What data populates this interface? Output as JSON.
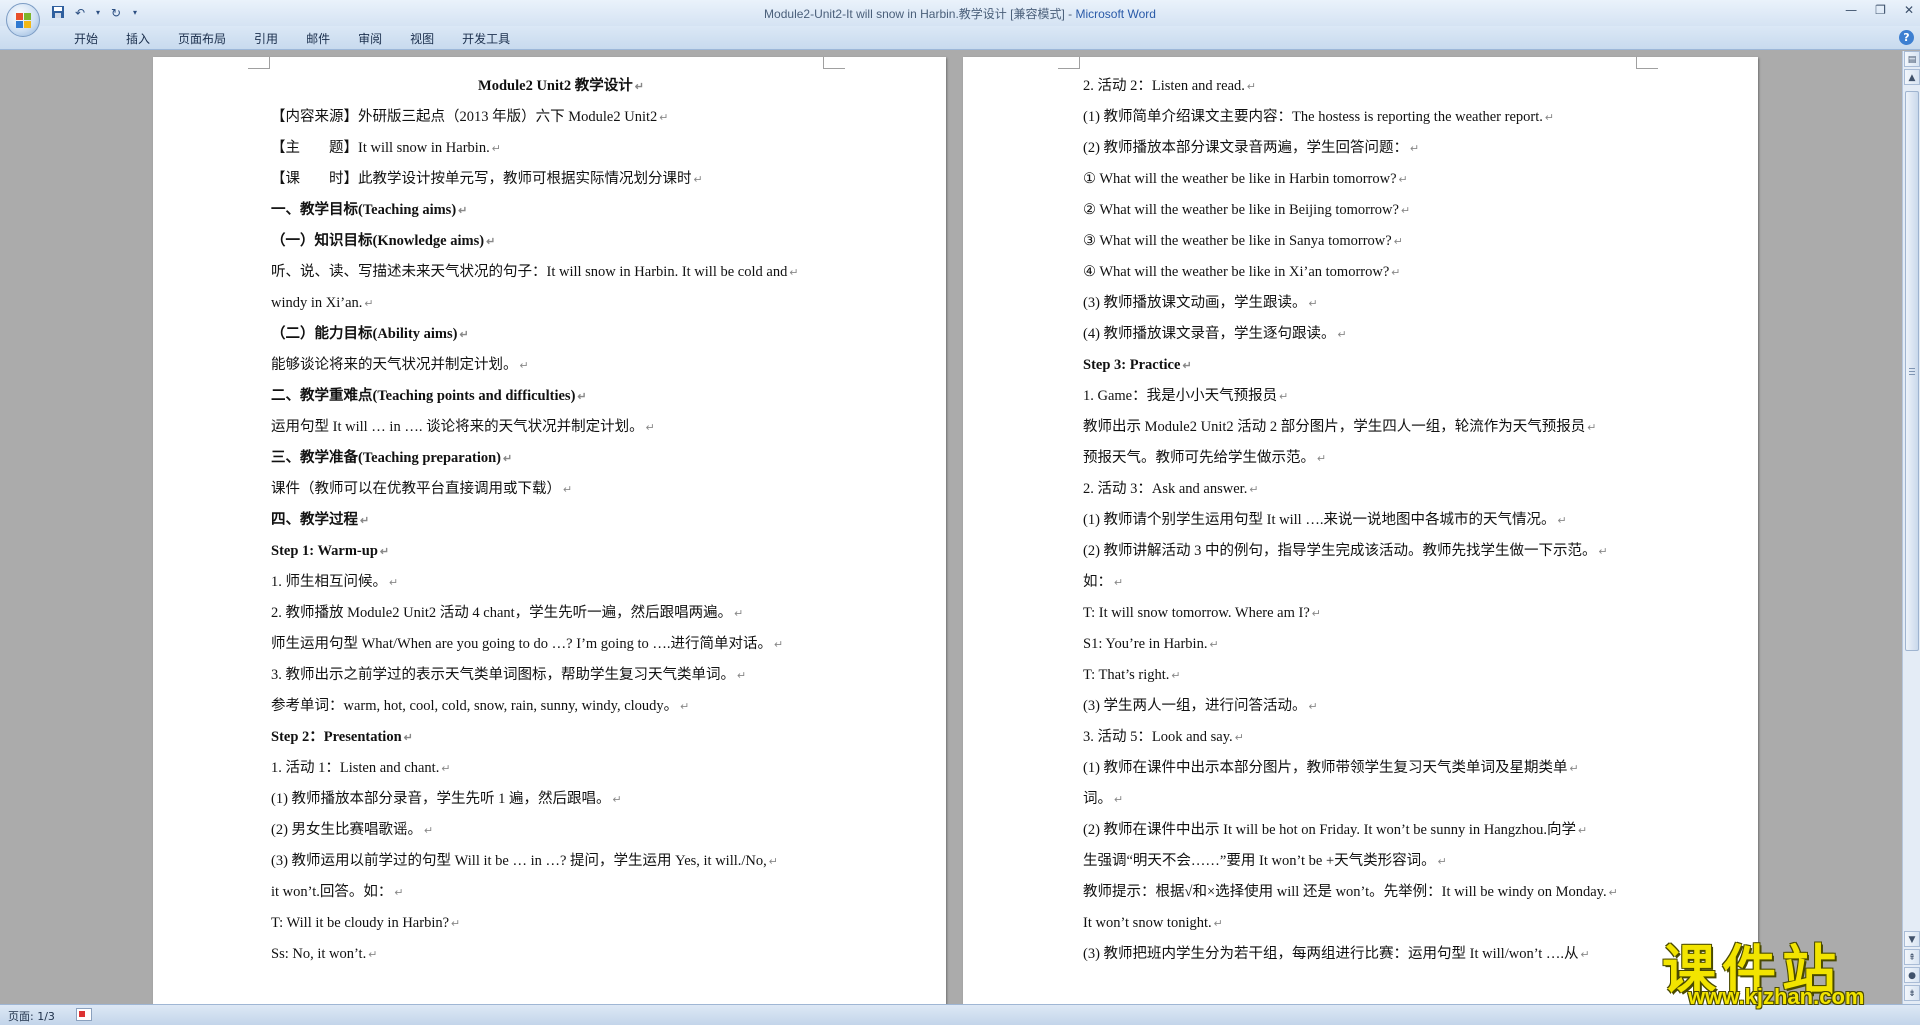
{
  "window": {
    "title": "Module2-Unit2-It will snow in Harbin.教学设计 [兼容模式] - ",
    "app_name": "Microsoft Word"
  },
  "ribbon": {
    "tabs": [
      "开始",
      "插入",
      "页面布局",
      "引用",
      "邮件",
      "审阅",
      "视图",
      "开发工具"
    ]
  },
  "document": {
    "page1": [
      {
        "text": "Module2 Unit2 教学设计",
        "style": "title"
      },
      {
        "text": "【内容来源】外研版三起点（2013 年版）六下 Module2 Unit2",
        "style": "normal"
      },
      {
        "text": "【主　　题】It will snow in Harbin.",
        "style": "normal"
      },
      {
        "text": "【课　　时】此教学设计按单元写，教师可根据实际情况划分课时",
        "style": "normal"
      },
      {
        "text": "一、教学目标(Teaching aims)",
        "style": "bold"
      },
      {
        "text": "（一）知识目标(Knowledge aims)",
        "style": "bold"
      },
      {
        "text": "听、说、读、写描述未来天气状况的句子：It will snow in Harbin. It will be cold and",
        "style": "normal"
      },
      {
        "text": "windy in Xi’an.",
        "style": "normal"
      },
      {
        "text": "（二）能力目标(Ability aims)",
        "style": "bold"
      },
      {
        "text": "能够谈论将来的天气状况并制定计划。",
        "style": "normal"
      },
      {
        "text": "二、教学重难点(Teaching points and difficulties)",
        "style": "bold"
      },
      {
        "text": "运用句型 It will … in …. 谈论将来的天气状况并制定计划。",
        "style": "normal"
      },
      {
        "text": "三、教学准备(Teaching preparation)",
        "style": "bold"
      },
      {
        "text": "课件（教师可以在优教平台直接调用或下载）",
        "style": "normal"
      },
      {
        "text": "四、教学过程",
        "style": "bold"
      },
      {
        "text": "Step 1: Warm-up",
        "style": "bold"
      },
      {
        "text": "1. 师生相互问候。",
        "style": "normal"
      },
      {
        "text": "2. 教师播放 Module2 Unit2 活动 4 chant，学生先听一遍，然后跟唱两遍。",
        "style": "normal"
      },
      {
        "text": "师生运用句型 What/When are you going to do …? I’m going to ….进行简单对话。",
        "style": "normal"
      },
      {
        "text": "3. 教师出示之前学过的表示天气类单词图标，帮助学生复习天气类单词。",
        "style": "normal"
      },
      {
        "text": "参考单词：warm, hot, cool, cold, snow, rain, sunny, windy, cloudy。",
        "style": "normal"
      },
      {
        "text": "Step 2：Presentation",
        "style": "bold"
      },
      {
        "text": "1. 活动 1：Listen and chant.",
        "style": "normal"
      },
      {
        "text": "(1) 教师播放本部分录音，学生先听 1 遍，然后跟唱。",
        "style": "normal"
      },
      {
        "text": "(2) 男女生比赛唱歌谣。",
        "style": "normal"
      },
      {
        "text": "(3) 教师运用以前学过的句型 Will it be … in …? 提问，学生运用 Yes, it will./No,",
        "style": "normal"
      },
      {
        "text": "it won’t.回答。如：",
        "style": "normal"
      },
      {
        "text": "T: Will it be cloudy in Harbin?",
        "style": "normal"
      },
      {
        "text": "Ss: No, it won’t.",
        "style": "normal"
      }
    ],
    "page2": [
      {
        "text": "2. 活动 2：Listen and read.",
        "style": "normal"
      },
      {
        "text": "(1) 教师简单介绍课文主要内容：The hostess is reporting the weather report.",
        "style": "normal"
      },
      {
        "text": "(2) 教师播放本部分课文录音两遍，学生回答问题：",
        "style": "normal"
      },
      {
        "text": "① What will the weather be like in Harbin tomorrow?",
        "style": "normal"
      },
      {
        "text": "② What will the weather be like in Beijing tomorrow?",
        "style": "normal"
      },
      {
        "text": "③ What will the weather be like in Sanya tomorrow?",
        "style": "normal"
      },
      {
        "text": "④ What will the weather be like in Xi’an tomorrow?",
        "style": "normal"
      },
      {
        "text": "(3) 教师播放课文动画，学生跟读。",
        "style": "normal"
      },
      {
        "text": "(4) 教师播放课文录音，学生逐句跟读。",
        "style": "normal"
      },
      {
        "text": "Step 3: Practice",
        "style": "bold"
      },
      {
        "text": "1. Game：我是小小天气预报员",
        "style": "normal"
      },
      {
        "text": "教师出示 Module2 Unit2 活动 2 部分图片，学生四人一组，轮流作为天气预报员",
        "style": "normal"
      },
      {
        "text": "预报天气。教师可先给学生做示范。",
        "style": "normal"
      },
      {
        "text": "2. 活动 3：Ask and answer.",
        "style": "normal"
      },
      {
        "text": "(1) 教师请个别学生运用句型 It will ….来说一说地图中各城市的天气情况。",
        "style": "normal"
      },
      {
        "text": "(2) 教师讲解活动 3 中的例句，指导学生完成该活动。教师先找学生做一下示范。",
        "style": "normal"
      },
      {
        "text": "如：",
        "style": "normal"
      },
      {
        "text": "T: It will snow tomorrow. Where am I?",
        "style": "normal"
      },
      {
        "text": "S1: You’re in Harbin.",
        "style": "normal"
      },
      {
        "text": "T: That’s right.",
        "style": "normal"
      },
      {
        "text": "(3) 学生两人一组，进行问答活动。",
        "style": "normal"
      },
      {
        "text": "3. 活动 5：Look and say.",
        "style": "normal"
      },
      {
        "text": "(1) 教师在课件中出示本部分图片，教师带领学生复习天气类单词及星期类单",
        "style": "normal"
      },
      {
        "text": "词。",
        "style": "normal"
      },
      {
        "text": "(2) 教师在课件中出示 It will be hot on Friday. It won’t be sunny in Hangzhou.向学",
        "style": "normal"
      },
      {
        "text": "生强调“明天不会……”要用 It won’t be +天气类形容词。",
        "style": "normal"
      },
      {
        "text": "教师提示：根据√和×选择使用 will 还是 won’t。先举例：It will be windy on Monday.",
        "style": "normal"
      },
      {
        "text": "It won’t snow tonight.",
        "style": "normal"
      },
      {
        "text": "(3) 教师把班内学生分为若干组，每两组进行比赛：运用句型 It will/won’t ….从",
        "style": "normal"
      }
    ]
  },
  "status": {
    "page_indicator": "页面: 1/3"
  },
  "watermark": {
    "main": "课件站",
    "url": "www.kjzhan.com"
  },
  "colors": {
    "workspace_bg": "#ababab",
    "ribbon_bg": "#d5e3f3",
    "watermark_yellow": "#f2e400"
  }
}
